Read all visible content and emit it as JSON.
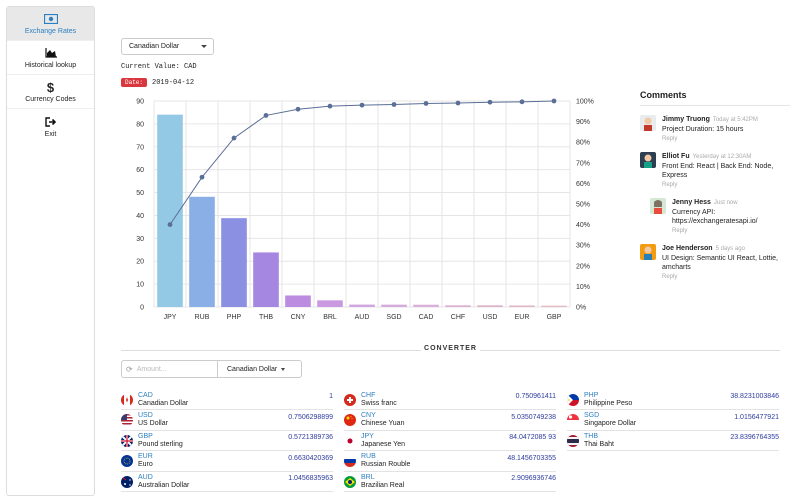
{
  "sidebar": {
    "items": [
      {
        "label": "Exchange Rates",
        "icon": "money-bill-icon",
        "active": true
      },
      {
        "label": "Historical lookup",
        "icon": "area-chart-icon",
        "active": false
      },
      {
        "label": "Currency Codes",
        "icon": "dollar-sign-icon",
        "active": false
      },
      {
        "label": "Exit",
        "icon": "sign-out-icon",
        "active": false
      }
    ]
  },
  "controls": {
    "currency": "Canadian Dollar",
    "current_value": "Current Value: CAD",
    "date_label": "Date:",
    "date_value": "2019-04-12"
  },
  "chart_data": {
    "type": "bar",
    "categories": [
      "JPY",
      "RUB",
      "PHP",
      "THB",
      "CNY",
      "BRL",
      "AUD",
      "SGD",
      "CAD",
      "CHF",
      "USD",
      "EUR",
      "GBP"
    ],
    "values": [
      84.04,
      48.15,
      38.82,
      23.84,
      5.04,
      2.91,
      1.05,
      1.02,
      1,
      0.75,
      0.75,
      0.66,
      0.57
    ],
    "line_values": [
      40,
      63,
      82,
      93,
      96,
      97.5,
      98,
      98.3,
      98.8,
      99,
      99.4,
      99.6,
      100
    ],
    "ylim": [
      0,
      90
    ],
    "y2lim": [
      0,
      100
    ],
    "yticks": [
      0,
      10,
      20,
      30,
      40,
      50,
      60,
      70,
      80,
      90
    ],
    "y2ticks": [
      "0%",
      "10%",
      "20%",
      "30%",
      "40%",
      "50%",
      "60%",
      "70%",
      "80%",
      "90%",
      "100%"
    ],
    "bar_colors": [
      "#93c9e4",
      "#8aaee6",
      "#8c90e3",
      "#a586e0",
      "#bb8ce0",
      "#c99ae1",
      "#d0a6e0",
      "#d4abdc",
      "#d8b0d8",
      "#dab2d2",
      "#dcb5cc",
      "#deb8c6",
      "#e0bcc0"
    ],
    "line_color": "#5a6e96",
    "grid": true
  },
  "comments": {
    "title": "Comments",
    "items": [
      {
        "author": "Jimmy Truong",
        "time": "Today at 5:42PM",
        "text": "Project Duration: 15 hours",
        "reply": "Reply",
        "nested": false
      },
      {
        "author": "Elliot Fu",
        "time": "Yesterday at 12:30AM",
        "text": "Front End: React | Back End: Node, Express",
        "reply": "Reply",
        "nested": false
      },
      {
        "author": "Jenny Hess",
        "time": "Just now",
        "text": "Currency API: https://exchangeratesapi.io/",
        "reply": "Reply",
        "nested": true
      },
      {
        "author": "Joe Henderson",
        "time": "5 days ago",
        "text": "UI Design: Semantic UI React, Lottie, amcharts",
        "reply": "Reply",
        "nested": false
      }
    ]
  },
  "converter": {
    "title": "CONVERTER",
    "amount_placeholder": "Amount...",
    "currency": "Canadian Dollar",
    "columns": [
      [
        {
          "code": "CAD",
          "name": "Canadian Dollar",
          "value": "1",
          "flag": "ca"
        },
        {
          "code": "USD",
          "name": "US Dollar",
          "value": "0.7506298899",
          "flag": "us"
        },
        {
          "code": "GBP",
          "name": "Pound sterling",
          "value": "0.5721389736",
          "flag": "gb"
        },
        {
          "code": "EUR",
          "name": "Euro",
          "value": "0.6630420369",
          "flag": "eu"
        },
        {
          "code": "AUD",
          "name": "Australian Dollar",
          "value": "1.0456835963",
          "flag": "au"
        }
      ],
      [
        {
          "code": "CHF",
          "name": "Swiss franc",
          "value": "0.750961411",
          "flag": "ch"
        },
        {
          "code": "CNY",
          "name": "Chinese Yuan",
          "value": "5.0350749238",
          "flag": "cn"
        },
        {
          "code": "JPY",
          "name": "Japanese Yen",
          "value": "84.0472085 93",
          "flag": "jp"
        },
        {
          "code": "RUB",
          "name": "Russian Rouble",
          "value": "48.1456703355",
          "flag": "ru"
        },
        {
          "code": "BRL",
          "name": "Brazilian Real",
          "value": "2.9096936746",
          "flag": "br"
        }
      ],
      [
        {
          "code": "PHP",
          "name": "Philippine Peso",
          "value": "38.8231003846",
          "flag": "ph"
        },
        {
          "code": "SGD",
          "name": "Singapore Dollar",
          "value": "1.0156477921",
          "flag": "sg"
        },
        {
          "code": "THB",
          "name": "Thai Baht",
          "value": "23.8396764355",
          "flag": "th"
        }
      ]
    ]
  }
}
